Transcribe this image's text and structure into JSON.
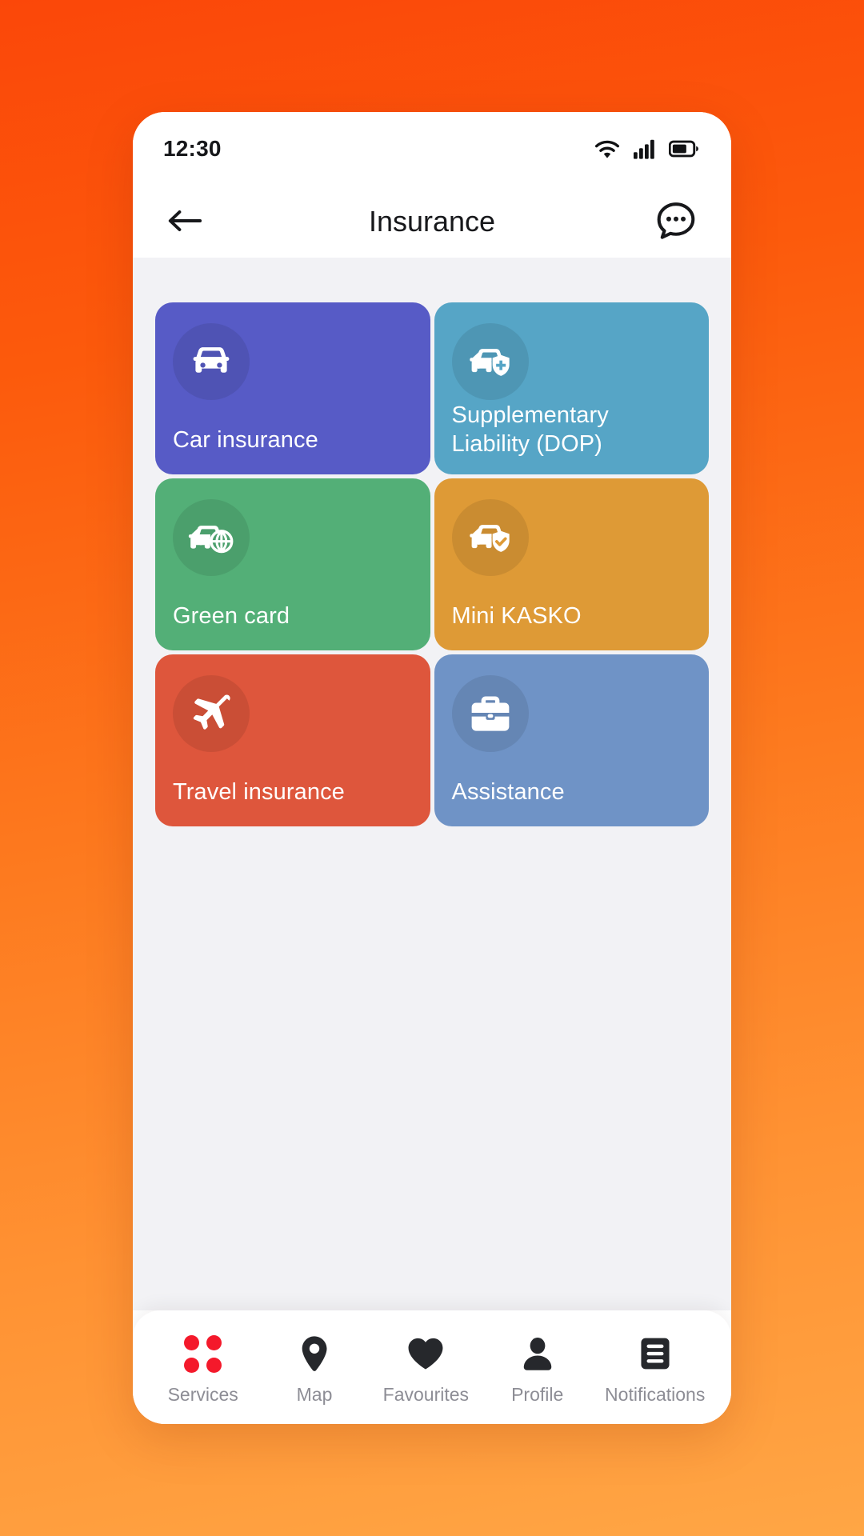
{
  "theme": {
    "bg_gradient_top": "#FB4709",
    "bg_gradient_bottom": "#FFA645",
    "screen_bg": "#F2F2F5",
    "phone_bg": "#FFFFFF",
    "accent_red": "#F4192B",
    "nav_label_color": "#8D8D95",
    "title_color": "#17181B"
  },
  "statusbar": {
    "time": "12:30",
    "icons": [
      "wifi-icon",
      "cellular-signal-icon",
      "battery-icon"
    ]
  },
  "header": {
    "back_icon": "arrow-left-icon",
    "title": "Insurance",
    "chat_icon": "chat-bubble-dots-icon"
  },
  "main": {
    "cards": [
      {
        "label": "Car insurance",
        "icon": "car-front-icon",
        "color": "#575BC6",
        "icon_bg": "rgba(0,0,0,0.085)"
      },
      {
        "label": "Supplementary Liability (DOP)",
        "icon": "car-shield-plus-icon",
        "color": "#56A5C6",
        "icon_bg": "rgba(0,0,0,0.085)"
      },
      {
        "label": "Green card",
        "icon": "car-globe-icon",
        "color": "#53AF77",
        "icon_bg": "rgba(0,0,0,0.085)"
      },
      {
        "label": "Mini KASKO",
        "icon": "car-shield-check-icon",
        "color": "#DE9A36",
        "icon_bg": "rgba(0,0,0,0.085)"
      },
      {
        "label": "Travel insurance",
        "icon": "airplane-icon",
        "color": "#DE563C",
        "icon_bg": "rgba(0,0,0,0.085)"
      },
      {
        "label": "Assistance",
        "icon": "briefcase-icon",
        "color": "#6F93C6",
        "icon_bg": "rgba(0,0,0,0.085)"
      }
    ]
  },
  "bottom_nav": {
    "items": [
      {
        "label": "Services",
        "icon": "grid-dots-icon",
        "active": true
      },
      {
        "label": "Map",
        "icon": "map-pin-icon",
        "active": false
      },
      {
        "label": "Favourites",
        "icon": "heart-icon",
        "active": false
      },
      {
        "label": "Profile",
        "icon": "person-icon",
        "active": false
      },
      {
        "label": "Notifications",
        "icon": "list-doc-icon",
        "active": false
      }
    ]
  }
}
